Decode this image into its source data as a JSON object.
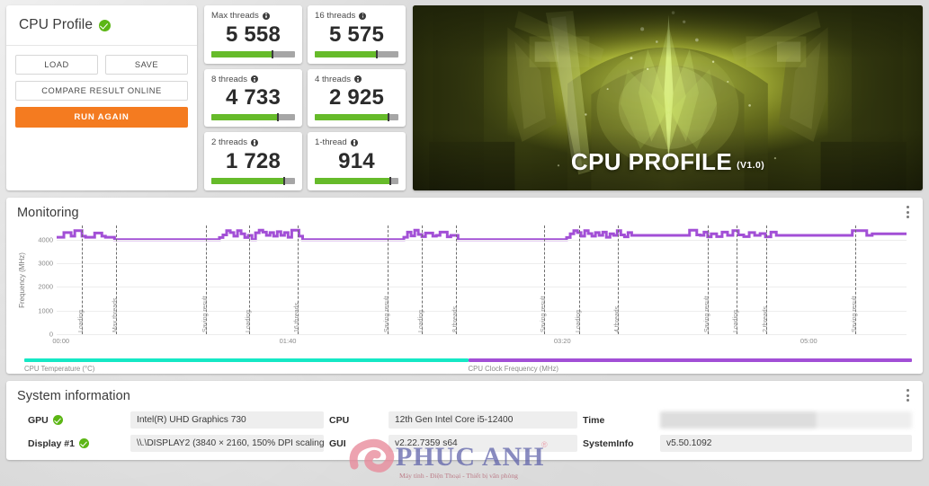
{
  "left_panel": {
    "title": "CPU Profile",
    "status_icon": "check-circle-icon",
    "buttons": {
      "load": "LOAD",
      "save": "SAVE",
      "compare": "COMPARE RESULT ONLINE",
      "run_again": "RUN AGAIN"
    }
  },
  "scores": [
    {
      "label": "Max threads",
      "value": "5 558",
      "fill_pct": 72,
      "marker_pct": 72
    },
    {
      "label": "16 threads",
      "value": "5 575",
      "fill_pct": 73,
      "marker_pct": 73
    },
    {
      "label": "8 threads",
      "value": "4 733",
      "fill_pct": 79,
      "marker_pct": 79
    },
    {
      "label": "4 threads",
      "value": "2 925",
      "fill_pct": 87,
      "marker_pct": 87
    },
    {
      "label": "2 threads",
      "value": "1 728",
      "fill_pct": 86,
      "marker_pct": 86
    },
    {
      "label": "1-thread",
      "value": "914",
      "fill_pct": 89,
      "marker_pct": 89
    }
  ],
  "hero": {
    "title": "CPU PROFILE",
    "version": "(V1.0)"
  },
  "monitoring": {
    "title": "Monitoring",
    "menu_icon": "kebab-menu-icon"
  },
  "system_information": {
    "title": "System information",
    "menu_icon": "kebab-menu-icon",
    "rows": [
      {
        "key": "GPU",
        "has_check": true,
        "value": "Intel(R) UHD Graphics 730"
      },
      {
        "key": "CPU",
        "has_check": false,
        "value": "12th Gen Intel Core i5-12400"
      },
      {
        "key": "Time",
        "has_check": false,
        "value": "",
        "blurred": true
      },
      {
        "key": "Display #1",
        "has_check": true,
        "value": "\\\\.\\DISPLAY2 (3840 × 2160, 150% DPI scaling)"
      },
      {
        "key": "GUI",
        "has_check": false,
        "value": "v2.22.7359 s64"
      },
      {
        "key": "SystemInfo",
        "has_check": false,
        "value": "v5.50.1092"
      }
    ]
  },
  "colors": {
    "accent_orange": "#f47b20",
    "bar_green": "#66bb2a",
    "bar_track": "#a6a6a6",
    "check_green": "#5cb615",
    "cpu_clock_purple": "#a24fd6",
    "cpu_temp_cyan": "#15e8c5",
    "page_bg": "#dcdcdc"
  },
  "chart_data": {
    "type": "line",
    "title": "Monitoring",
    "xlabel": "",
    "ylabel": "Frequency (MHz)",
    "ylim": [
      0,
      4600
    ],
    "yticks": [
      0,
      1000,
      2000,
      3000,
      4000
    ],
    "xticks": [
      "00:00",
      "01:40",
      "03:20",
      "05:00"
    ],
    "xtick_positions_pct": [
      0.5,
      27.2,
      59.5,
      88.5
    ],
    "grid": true,
    "legend_position": "bottom",
    "legend": [
      {
        "name": "CPU Temperature (°C)",
        "color": "#15e8c5"
      },
      {
        "name": "CPU Clock Frequency (MHz)",
        "color": "#a24fd6"
      }
    ],
    "series": [
      {
        "name": "CPU Clock Frequency (MHz)",
        "color": "#a24fd6",
        "unit": "MHz",
        "points": [
          [
            0.0,
            4100
          ],
          [
            0.8,
            4100
          ],
          [
            1.2,
            4300
          ],
          [
            1.6,
            4300
          ],
          [
            2.0,
            4150
          ],
          [
            2.4,
            4380
          ],
          [
            2.8,
            4380
          ],
          [
            3.2,
            4150
          ],
          [
            3.6,
            4100
          ],
          [
            4.2,
            4100
          ],
          [
            4.6,
            4280
          ],
          [
            5.0,
            4280
          ],
          [
            5.4,
            4150
          ],
          [
            5.8,
            4100
          ],
          [
            6.4,
            4100
          ],
          [
            6.6,
            4000
          ],
          [
            7.0,
            4000
          ],
          [
            17.5,
            4000
          ],
          [
            18.0,
            4000
          ],
          [
            18.4,
            4090
          ],
          [
            18.8,
            4200
          ],
          [
            19.2,
            4380
          ],
          [
            19.6,
            4300
          ],
          [
            20.0,
            4150
          ],
          [
            20.4,
            4380
          ],
          [
            20.8,
            4250
          ],
          [
            21.2,
            4090
          ],
          [
            21.6,
            4180
          ],
          [
            22.0,
            4000
          ],
          [
            22.4,
            4290
          ],
          [
            22.8,
            4400
          ],
          [
            23.2,
            4320
          ],
          [
            23.6,
            4180
          ],
          [
            24.0,
            4300
          ],
          [
            24.4,
            4150
          ],
          [
            24.8,
            4340
          ],
          [
            25.2,
            4180
          ],
          [
            25.6,
            4300
          ],
          [
            26.0,
            4100
          ],
          [
            26.4,
            4400
          ],
          [
            26.8,
            4400
          ],
          [
            27.2,
            4150
          ],
          [
            27.6,
            4000
          ],
          [
            28.0,
            4000
          ],
          [
            38.0,
            4000
          ],
          [
            38.4,
            4000
          ],
          [
            38.8,
            4100
          ],
          [
            39.2,
            4320
          ],
          [
            39.6,
            4160
          ],
          [
            40.0,
            4400
          ],
          [
            40.4,
            4220
          ],
          [
            40.8,
            4130
          ],
          [
            41.2,
            4280
          ],
          [
            41.6,
            4280
          ],
          [
            42.0,
            4150
          ],
          [
            42.4,
            4180
          ],
          [
            42.8,
            4320
          ],
          [
            43.2,
            4320
          ],
          [
            43.6,
            4120
          ],
          [
            44.0,
            4180
          ],
          [
            44.4,
            4180
          ],
          [
            44.8,
            4000
          ],
          [
            45.2,
            4000
          ],
          [
            56.0,
            4000
          ],
          [
            56.4,
            4000
          ],
          [
            56.8,
            4090
          ],
          [
            57.2,
            4250
          ],
          [
            57.6,
            4380
          ],
          [
            58.0,
            4300
          ],
          [
            58.4,
            4150
          ],
          [
            58.8,
            4380
          ],
          [
            59.2,
            4260
          ],
          [
            59.6,
            4150
          ],
          [
            60.0,
            4300
          ],
          [
            60.4,
            4180
          ],
          [
            60.8,
            4320
          ],
          [
            61.2,
            4100
          ],
          [
            61.6,
            4250
          ],
          [
            62.0,
            4180
          ],
          [
            62.4,
            4380
          ],
          [
            62.8,
            4200
          ],
          [
            63.2,
            4120
          ],
          [
            63.6,
            4300
          ],
          [
            64.0,
            4180
          ],
          [
            64.4,
            4180
          ],
          [
            64.8,
            4180
          ],
          [
            65.2,
            4180
          ],
          [
            70.0,
            4180
          ],
          [
            70.4,
            4400
          ],
          [
            70.8,
            4400
          ],
          [
            71.2,
            4200
          ],
          [
            71.6,
            4180
          ],
          [
            72.0,
            4320
          ],
          [
            72.4,
            4120
          ],
          [
            73.0,
            4250
          ],
          [
            73.6,
            4130
          ],
          [
            74.2,
            4320
          ],
          [
            74.8,
            4180
          ],
          [
            75.4,
            4380
          ],
          [
            76.0,
            4200
          ],
          [
            76.6,
            4130
          ],
          [
            77.2,
            4300
          ],
          [
            77.8,
            4180
          ],
          [
            78.4,
            4260
          ],
          [
            79.0,
            4120
          ],
          [
            79.6,
            4320
          ],
          [
            80.2,
            4180
          ],
          [
            80.8,
            4180
          ],
          [
            82.0,
            4180
          ],
          [
            84.0,
            4180
          ],
          [
            86.0,
            4180
          ],
          [
            88.0,
            4180
          ],
          [
            89.0,
            4380
          ],
          [
            89.6,
            4380
          ],
          [
            90.2,
            4180
          ],
          [
            91.0,
            4250
          ],
          [
            92.0,
            4250
          ],
          [
            94.0,
            4250
          ]
        ]
      }
    ],
    "annotations": [
      {
        "label": "Loading",
        "x_pct": 3.0
      },
      {
        "label": "Max threads",
        "x_pct": 7.0
      },
      {
        "label": "Saving result",
        "x_pct": 17.6
      },
      {
        "label": "Loading",
        "x_pct": 22.6
      },
      {
        "label": "16 threads",
        "x_pct": 28.4
      },
      {
        "label": "Saving result",
        "x_pct": 38.9
      },
      {
        "label": "Loading",
        "x_pct": 43.0
      },
      {
        "label": "8 threads",
        "x_pct": 47.0
      },
      {
        "label": "Saving result",
        "x_pct": 57.4
      },
      {
        "label": "Loading",
        "x_pct": 61.5
      },
      {
        "label": "4 threads",
        "x_pct": 66.0
      },
      {
        "label": "Saving result",
        "x_pct": 76.6
      },
      {
        "label": "Loading",
        "x_pct": 80.0
      },
      {
        "label": "2 threads",
        "x_pct": 83.5
      },
      {
        "label": "Saving result",
        "x_pct": 94.0
      }
    ]
  }
}
